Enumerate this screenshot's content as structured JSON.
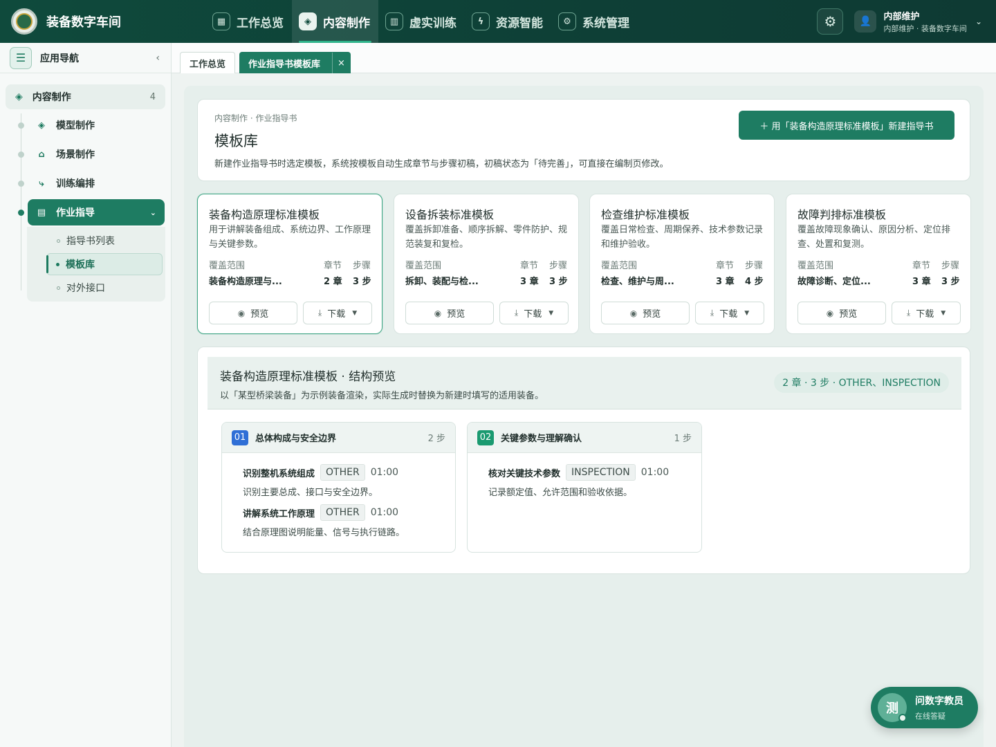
{
  "app": {
    "title": "装备数字车间"
  },
  "topnav": [
    {
      "label": "工作总览",
      "icon": "grid-icon"
    },
    {
      "label": "内容制作",
      "icon": "cube-icon",
      "active": true
    },
    {
      "label": "虚实训练",
      "icon": "book-icon"
    },
    {
      "label": "资源智能",
      "icon": "spark-icon"
    },
    {
      "label": "系统管理",
      "icon": "gear-icon"
    }
  ],
  "user": {
    "name": "内部维护",
    "sub": "内部维护 · 装备数字车间"
  },
  "sidebar": {
    "title": "应用导航",
    "group": {
      "label": "内容制作",
      "count": "4"
    },
    "items": [
      {
        "label": "模型制作",
        "icon": "cube-icon"
      },
      {
        "label": "场景制作",
        "icon": "building-icon"
      },
      {
        "label": "训练编排",
        "icon": "flow-icon"
      },
      {
        "label": "作业指导",
        "icon": "document-icon",
        "active": true
      }
    ],
    "subitems": [
      {
        "label": "指导书列表"
      },
      {
        "label": "模板库",
        "active": true
      },
      {
        "label": "对外接口"
      }
    ]
  },
  "tabs": [
    {
      "label": "工作总览"
    },
    {
      "label": "作业指导书模板库",
      "active": true
    }
  ],
  "hero": {
    "crumb": "内容制作 · 作业指导书",
    "title": "模板库",
    "desc": "新建作业指导书时选定模板，系统按模板自动生成章节与步骤初稿，初稿状态为「待完善」，可直接在编制页修改。",
    "new_button": "＋  用「装备构造原理标准模板」新建指导书"
  },
  "labels": {
    "coverage": "覆盖范围",
    "chapters": "章节",
    "steps": "步骤",
    "preview": "预览",
    "download": "下载"
  },
  "templates": [
    {
      "title": "装备构造原理标准模板",
      "desc": "用于讲解装备组成、系统边界、工作原理与关键参数。",
      "coverage": "装备构造原理与...",
      "chapters": "2 章",
      "steps": "3 步",
      "selected": true
    },
    {
      "title": "设备拆装标准模板",
      "desc": "覆盖拆卸准备、顺序拆解、零件防护、规范装复和复检。",
      "coverage": "拆卸、装配与检...",
      "chapters": "3 章",
      "steps": "3 步"
    },
    {
      "title": "检查维护标准模板",
      "desc": "覆盖日常检查、周期保养、技术参数记录和维护验收。",
      "coverage": "检查、维护与周...",
      "chapters": "3 章",
      "steps": "4 步"
    },
    {
      "title": "故障判排标准模板",
      "desc": "覆盖故障现象确认、原因分析、定位排查、处置和复测。",
      "coverage": "故障诊断、定位...",
      "chapters": "3 章",
      "steps": "3 步"
    }
  ],
  "preview": {
    "title": "装备构造原理标准模板 · 结构预览",
    "desc": "以「某型桥梁装备」为示例装备渲染，实际生成时替换为新建时填写的适用装备。",
    "badge": "2 章 · 3 步 · OTHER、INSPECTION",
    "chapters": [
      {
        "num": "01",
        "title": "总体构成与安全边界",
        "count": "2 步",
        "color": "#2f6fd6",
        "steps": [
          {
            "name": "识别整机系统组成",
            "tag": "OTHER",
            "time": "01:00",
            "desc": "识别主要总成、接口与安全边界。"
          },
          {
            "name": "讲解系统工作原理",
            "tag": "OTHER",
            "time": "01:00",
            "desc": "结合原理图说明能量、信号与执行链路。"
          }
        ]
      },
      {
        "num": "02",
        "title": "关键参数与理解确认",
        "count": "1 步",
        "color": "#1a9a70",
        "steps": [
          {
            "name": "核对关键技术参数",
            "tag": "INSPECTION",
            "time": "01:00",
            "desc": "记录额定值、允许范围和验收依据。"
          }
        ]
      }
    ]
  },
  "assistant": {
    "avatar": "测",
    "name": "问数字教员",
    "sub": "在线答疑"
  }
}
